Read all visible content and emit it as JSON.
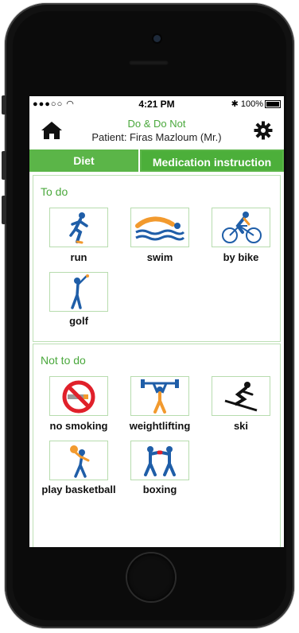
{
  "status_bar": {
    "carrier": "●●●○○",
    "time": "4:21 PM",
    "battery": "100%"
  },
  "header": {
    "title": "Do & Do Not",
    "patient": "Patient: Firas Mazloum (Mr.)",
    "home_icon": "home-icon",
    "settings_icon": "gear-icon"
  },
  "tabs": [
    {
      "label": "Diet"
    },
    {
      "label": "Medication instruction"
    }
  ],
  "todo": {
    "title": "To do",
    "items": [
      {
        "label": "run",
        "icon": "runner-icon"
      },
      {
        "label": "swim",
        "icon": "swimmer-icon"
      },
      {
        "label": "by bike",
        "icon": "cyclist-icon"
      },
      {
        "label": "golf",
        "icon": "golfer-icon"
      }
    ]
  },
  "nottodo": {
    "title": "Not to do",
    "items": [
      {
        "label": "no smoking",
        "icon": "no-smoking-icon"
      },
      {
        "label": "weightlifting",
        "icon": "weightlifter-icon"
      },
      {
        "label": "ski",
        "icon": "skier-icon"
      },
      {
        "label": "play basketball",
        "icon": "basketball-player-icon"
      },
      {
        "label": "boxing",
        "icon": "boxers-icon"
      }
    ]
  },
  "colors": {
    "accent": "#5bb548",
    "icon_blue": "#1f5ea8",
    "icon_orange": "#f29a2e"
  }
}
